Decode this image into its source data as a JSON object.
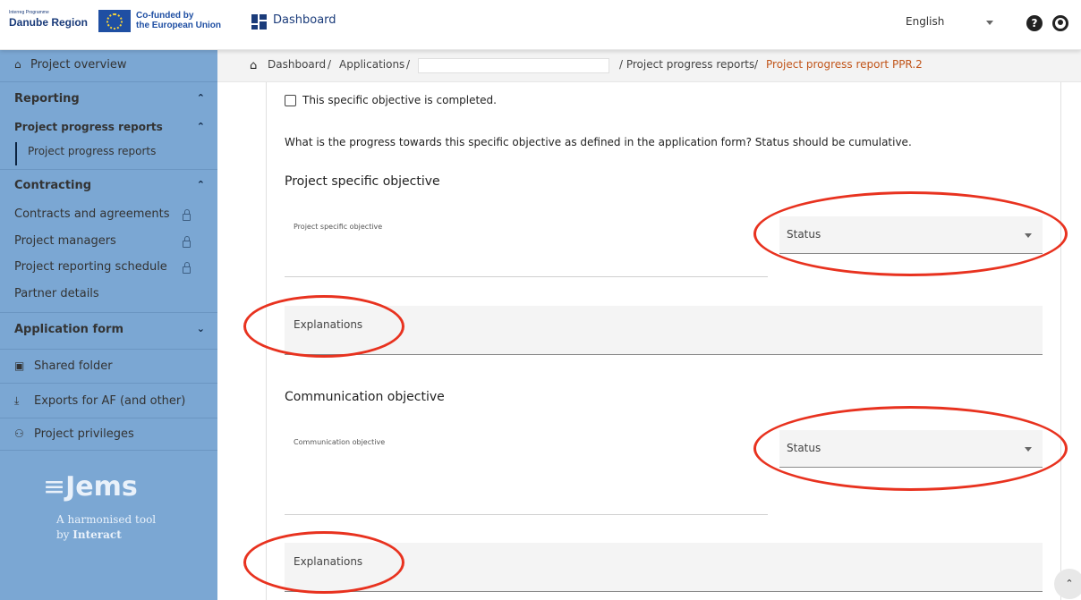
{
  "header": {
    "logo_small": "Interreg Programme",
    "logo_main": "Danube Region",
    "cofunded_line1": "Co-funded by",
    "cofunded_line2": "the European Union",
    "dashboard_label": "Dashboard",
    "language_value": "English",
    "help_icon": "?"
  },
  "sidebar": {
    "project_overview": "Project overview",
    "reporting": "Reporting",
    "project_progress_reports": "Project progress reports",
    "project_progress_reports_sub": "Project progress reports",
    "contracting": "Contracting",
    "contracts_and_agreements": "Contracts and agreements",
    "project_managers": "Project managers",
    "project_reporting_schedule": "Project reporting schedule",
    "partner_details": "Partner details",
    "application_form": "Application form",
    "shared_folder": "Shared folder",
    "exports": "Exports for AF (and other)",
    "project_privileges": "Project privileges",
    "brand": "Jems",
    "tagline1": "A harmonised tool",
    "tagline2_prefix": "by ",
    "tagline2_bold": "Interact"
  },
  "breadcrumb": {
    "dashboard": "Dashboard",
    "sep1": "/",
    "applications": "Applications",
    "sep2": "/",
    "ppr": "/ Project progress reports",
    "sep3": "/",
    "current": "Project progress report PPR.2"
  },
  "form": {
    "checkbox_label": "This specific objective is completed.",
    "question": "What is the progress towards this specific objective as defined in the application form? Status should be cumulative.",
    "section1_heading": "Project specific objective",
    "section1_field_label": "Project specific objective",
    "section1_status": "Status",
    "section1_explanations": "Explanations",
    "section2_heading": "Communication objective",
    "section2_field_label": "Communication objective",
    "section2_status": "Status",
    "section2_explanations": "Explanations"
  },
  "icons": {
    "home": "home-icon",
    "dashboard": "dashboard-icon",
    "help": "help-icon",
    "account": "account-icon",
    "lock": "lock-icon",
    "folder": "folder-icon",
    "download": "download-icon",
    "privileges": "privileges-icon",
    "scroll_top": "chevron-up-icon"
  },
  "colors": {
    "sidebar_bg": "#7ba7d3",
    "accent_orange": "#c1551a",
    "annotation_red": "#e8321f",
    "brand_blue": "#1a3b7a"
  }
}
